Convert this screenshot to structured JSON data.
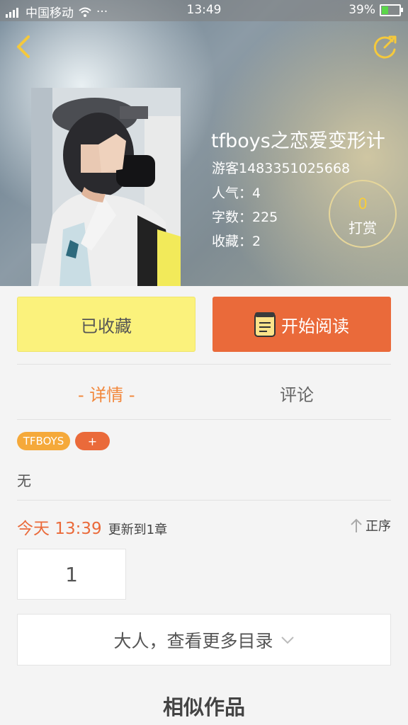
{
  "status_bar": {
    "carrier": "中国移动",
    "network": "4G",
    "dots": "···",
    "time": "13:49",
    "battery": "39%",
    "battery_level": 0.39
  },
  "header": {
    "back_icon": "chevron-left-icon",
    "share_icon": "share-icon"
  },
  "book": {
    "title": "tfboys之恋爱变形计",
    "author": "游客1483351025668",
    "popularity": "人气：4",
    "word_count": "字数：225",
    "favorites": "收藏：2",
    "reward_count": "0",
    "reward_label": "打赏"
  },
  "actions": {
    "favorited_label": "已收藏",
    "read_label": "开始阅读"
  },
  "tabs": [
    {
      "label": "- 详情 -",
      "active": true
    },
    {
      "label": "评论",
      "active": false
    }
  ],
  "tags": [
    {
      "label": "TFBOYS"
    },
    {
      "label": "+"
    }
  ],
  "description": "无",
  "update": {
    "time": "今天 13:39",
    "text": "更新到1章",
    "order_label": "正序"
  },
  "chapters": [
    "1"
  ],
  "more_label": "大人，查看更多目录",
  "similar_title": "相似作品",
  "colors": {
    "accent_orange": "#ea6a3a",
    "tab_active": "#f2873b",
    "favorite_yellow": "#fbf27c",
    "tag_yellow": "#f5a93a"
  }
}
